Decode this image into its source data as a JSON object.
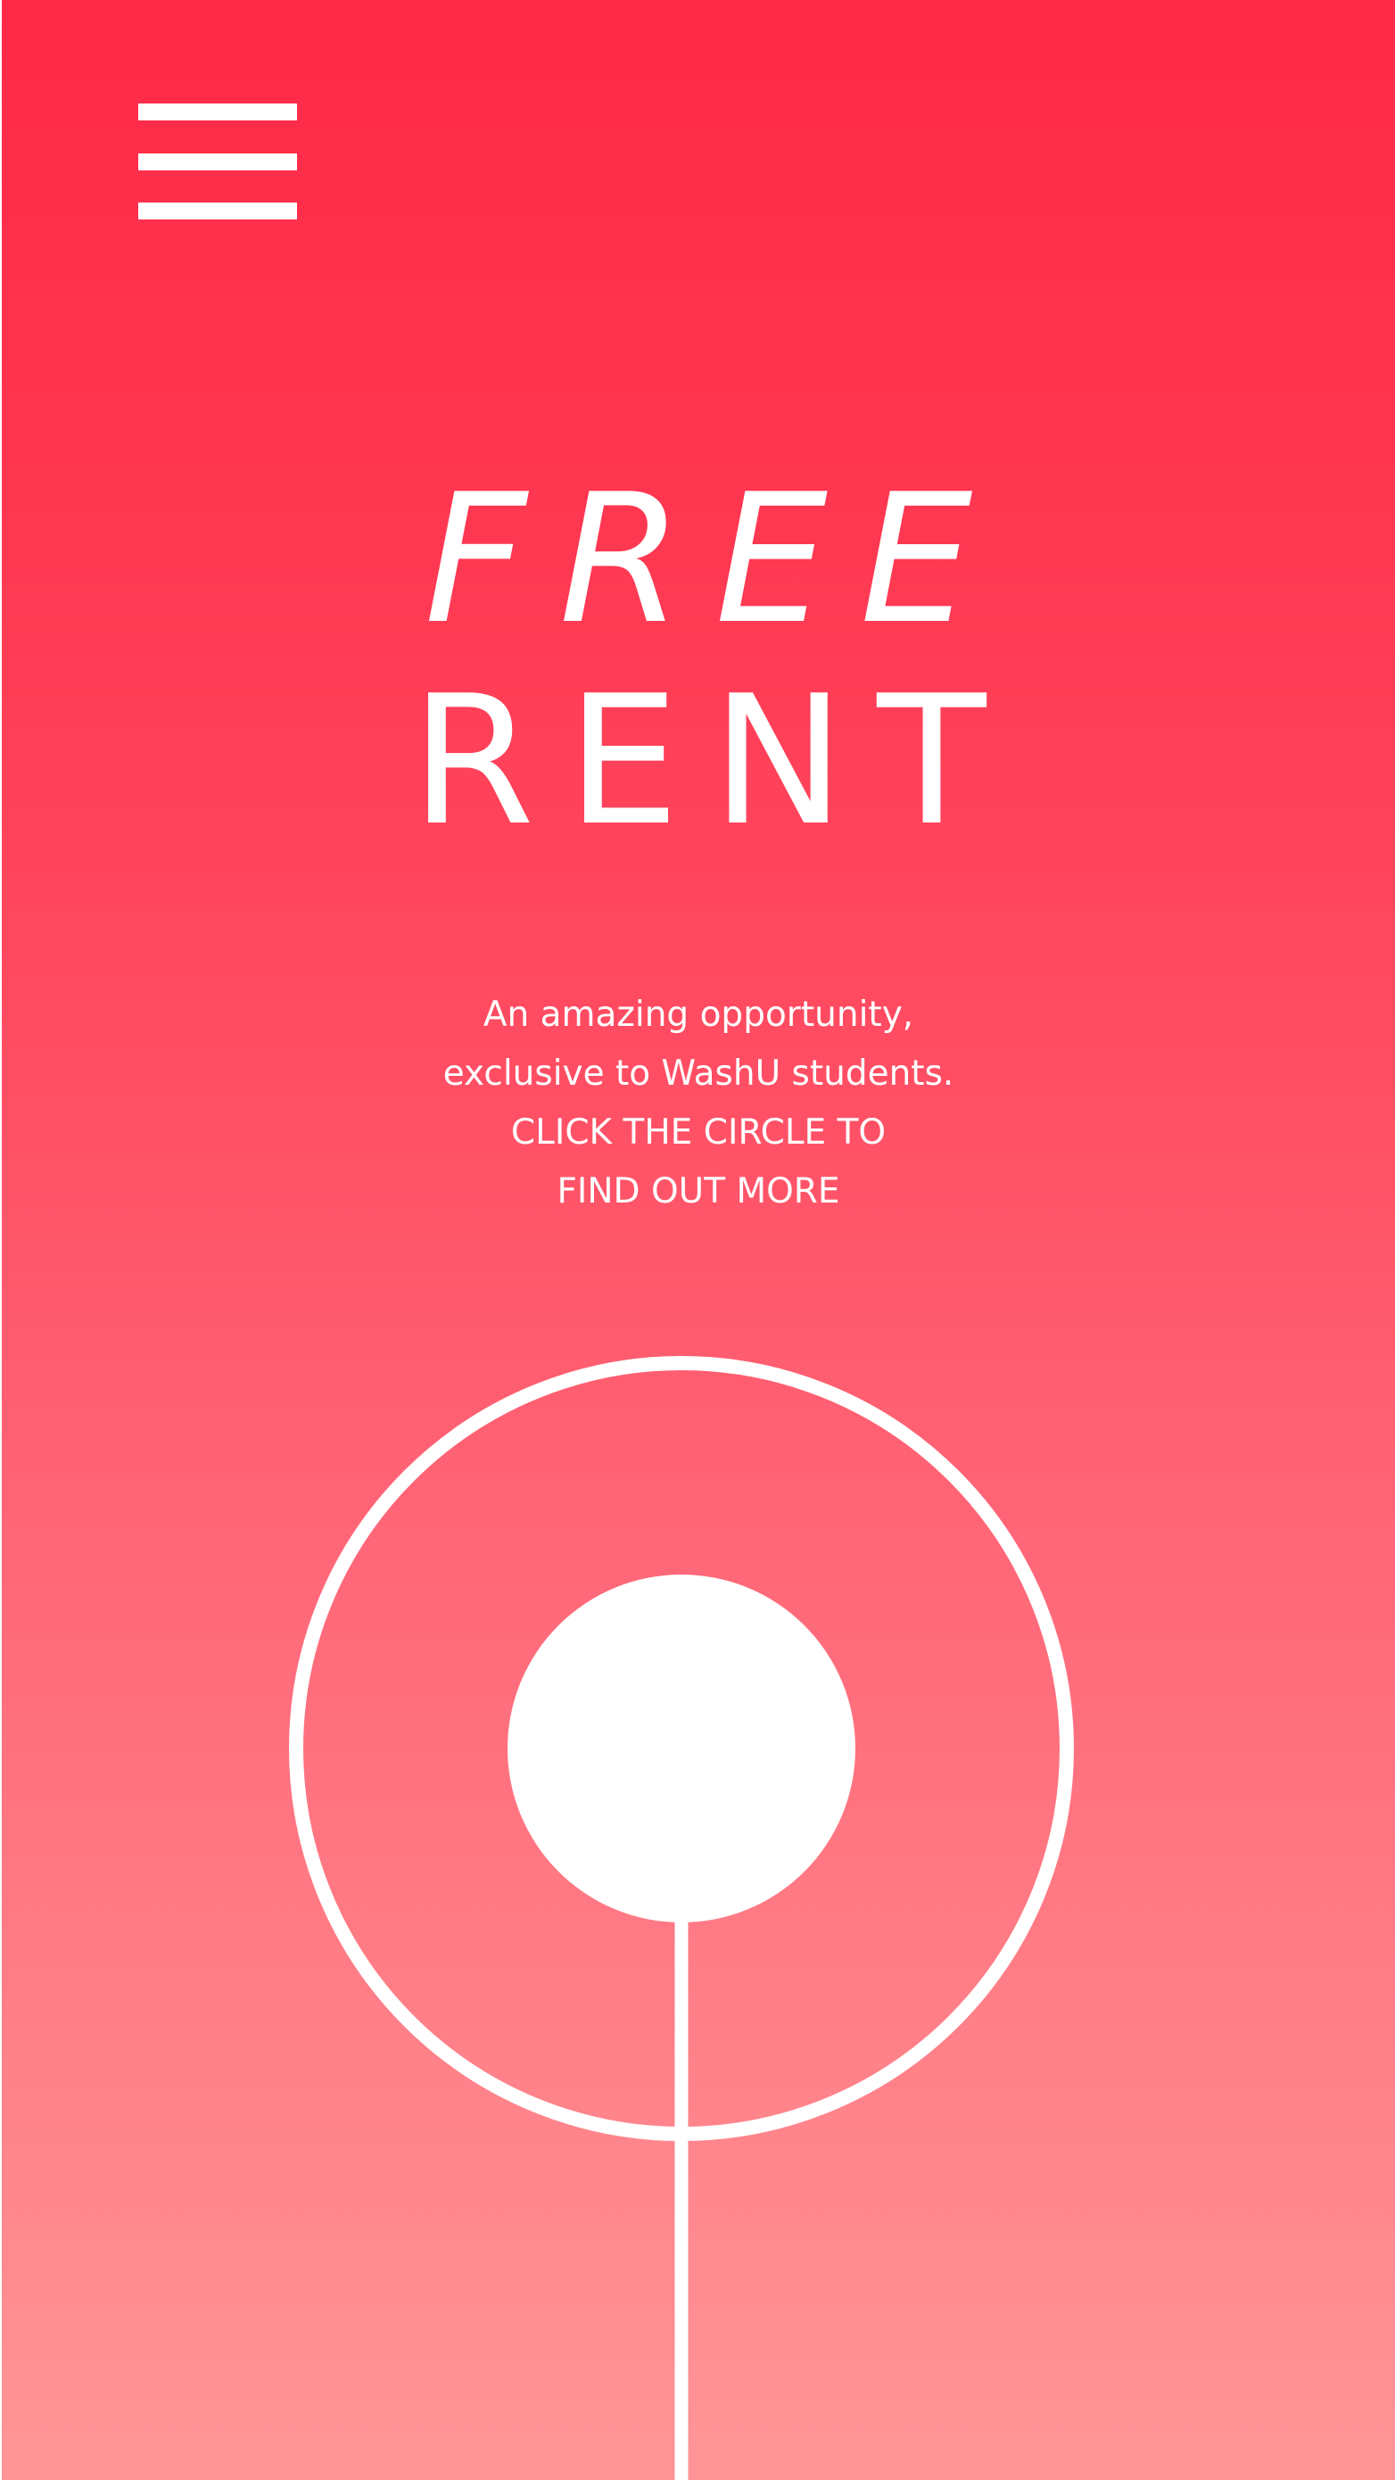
{
  "hero": {
    "title_line_1": "FREE",
    "title_line_2": "RENT"
  },
  "description": {
    "line_1": "An amazing opportunity,",
    "line_2": "exclusive to WashU students.",
    "line_3": "CLICK THE CIRCLE TO",
    "line_4": "FIND OUT MORE"
  },
  "menu": {
    "icon": "hamburger-menu-icon"
  },
  "colors": {
    "gradient_top": "#ff2a48",
    "gradient_bottom": "#ff9597",
    "foreground": "#ffffff"
  }
}
